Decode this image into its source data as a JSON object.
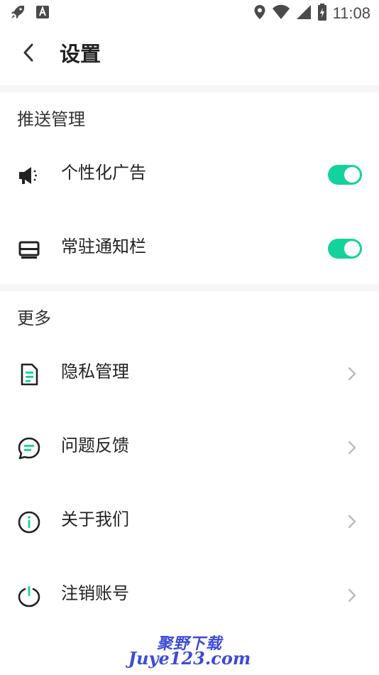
{
  "status_bar": {
    "time": "11:08",
    "icons": [
      "rocket-icon",
      "text-a-icon",
      "location-icon",
      "wifi-icon",
      "signal-icon",
      "battery-icon"
    ]
  },
  "header": {
    "title": "设置",
    "back_icon": "chevron-left-icon"
  },
  "sections": {
    "push": {
      "title": "推送管理",
      "items": [
        {
          "label": "个性化广告",
          "icon": "megaphone-icon",
          "toggle": true
        },
        {
          "label": "常驻通知栏",
          "icon": "notification-bar-icon",
          "toggle": true
        }
      ]
    },
    "more": {
      "title": "更多",
      "items": [
        {
          "label": "隐私管理",
          "icon": "document-icon"
        },
        {
          "label": "问题反馈",
          "icon": "feedback-chat-icon"
        },
        {
          "label": "关于我们",
          "icon": "info-icon"
        },
        {
          "label": "注销账号",
          "icon": "power-icon"
        }
      ]
    }
  },
  "watermark": {
    "line1": "聚野下载",
    "line2": "Juye123.com"
  },
  "colors": {
    "accent": "#14d39a",
    "band": "#f5f6f8",
    "watermark": "#3d4bd8",
    "chevron": "#b8bcc2"
  }
}
